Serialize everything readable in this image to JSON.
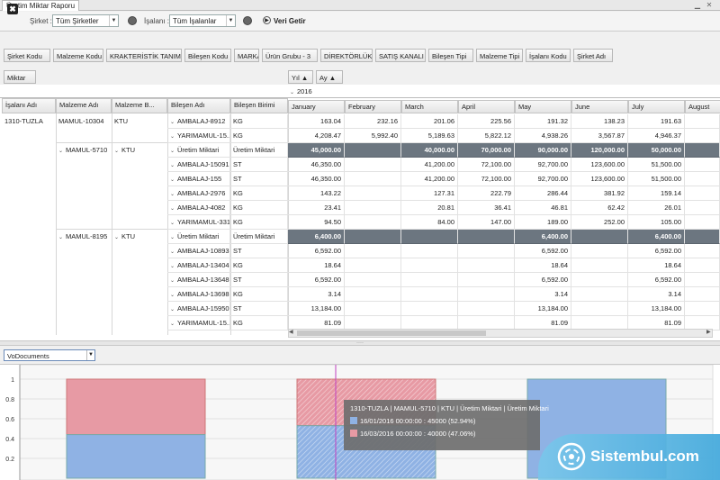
{
  "window": {
    "title": "Üretim Miktar Raporu"
  },
  "toolbar": {
    "sirket_label": "Şirket :",
    "sirket_value": "Tüm Şirketler",
    "isalani_label": "İşalanı :",
    "isalani_value": "Tüm İşalanlar",
    "run_label": "Veri Getir"
  },
  "filter_fields": [
    "Şirket Kodu",
    "Malzeme Kodu",
    "KRAKTERİSTİK TANIM",
    "Bileşen Kodu",
    "MARKA",
    "Ürün Grubu - 3",
    "DİREKTÖRLÜK",
    "SATIŞ KANALI",
    "Bileşen Tipi",
    "Malzeme Tipi",
    "İşalanı Kodu",
    "Şirket Adı"
  ],
  "data_field": "Miktar",
  "column_fields": {
    "yil": "Yıl",
    "ay": "Ay"
  },
  "row_headers": [
    "İşalanı Adı",
    "Malzeme Adı",
    "Malzeme B...",
    "Bileşen Adı",
    "Bileşen Birimi"
  ],
  "year": "2016",
  "months": [
    "January",
    "February",
    "March",
    "April",
    "May",
    "June",
    "July",
    "August"
  ],
  "groups": [
    {
      "isalani": "1310-TUZLA",
      "malzeme": "MAMUL-10304",
      "malzeme_b": "KTU"
    },
    {
      "malzeme": "MAMUL-5710",
      "malzeme_b": "KTU"
    },
    {
      "malzeme": "MAMUL-8195",
      "malzeme_b": "KTU"
    }
  ],
  "rows": [
    {
      "bilesen": "AMBALAJ-8912",
      "birim": "KG",
      "total": false,
      "values": [
        "163.04",
        "232.16",
        "201.06",
        "225.56",
        "191.32",
        "138.23",
        "191.63"
      ]
    },
    {
      "bilesen": "YARIMAMUL-15...",
      "birim": "KG",
      "total": false,
      "values": [
        "4,208.47",
        "5,992.40",
        "5,189.63",
        "5,822.12",
        "4,938.26",
        "3,567.87",
        "4,946.37"
      ]
    },
    {
      "bilesen": "Üretim Miktari",
      "birim": "Üretim Miktari",
      "total": true,
      "values": [
        "45,000.00",
        "",
        "40,000.00",
        "70,000.00",
        "90,000.00",
        "120,000.00",
        "50,000.00"
      ]
    },
    {
      "bilesen": "AMBALAJ-15091",
      "birim": "ST",
      "total": false,
      "values": [
        "46,350.00",
        "",
        "41,200.00",
        "72,100.00",
        "92,700.00",
        "123,600.00",
        "51,500.00"
      ]
    },
    {
      "bilesen": "AMBALAJ-155",
      "birim": "ST",
      "total": false,
      "values": [
        "46,350.00",
        "",
        "41,200.00",
        "72,100.00",
        "92,700.00",
        "123,600.00",
        "51,500.00"
      ]
    },
    {
      "bilesen": "AMBALAJ-2976",
      "birim": "KG",
      "total": false,
      "values": [
        "143.22",
        "",
        "127.31",
        "222.79",
        "286.44",
        "381.92",
        "159.14"
      ]
    },
    {
      "bilesen": "AMBALAJ-4082",
      "birim": "KG",
      "total": false,
      "values": [
        "23.41",
        "",
        "20.81",
        "36.41",
        "46.81",
        "62.42",
        "26.01"
      ]
    },
    {
      "bilesen": "YARIMAMUL-3319",
      "birim": "KG",
      "total": false,
      "values": [
        "94.50",
        "",
        "84.00",
        "147.00",
        "189.00",
        "252.00",
        "105.00"
      ]
    },
    {
      "bilesen": "Üretim Miktari",
      "birim": "Üretim Miktari",
      "total": true,
      "values": [
        "6,400.00",
        "",
        "",
        "",
        "6,400.00",
        "",
        "6,400.00"
      ]
    },
    {
      "bilesen": "AMBALAJ-10893",
      "birim": "ST",
      "total": false,
      "values": [
        "6,592.00",
        "",
        "",
        "",
        "6,592.00",
        "",
        "6,592.00"
      ]
    },
    {
      "bilesen": "AMBALAJ-13404",
      "birim": "KG",
      "total": false,
      "values": [
        "18.64",
        "",
        "",
        "",
        "18.64",
        "",
        "18.64"
      ]
    },
    {
      "bilesen": "AMBALAJ-13648",
      "birim": "ST",
      "total": false,
      "values": [
        "6,592.00",
        "",
        "",
        "",
        "6,592.00",
        "",
        "6,592.00"
      ]
    },
    {
      "bilesen": "AMBALAJ-13698",
      "birim": "KG",
      "total": false,
      "values": [
        "3.14",
        "",
        "",
        "",
        "3.14",
        "",
        "3.14"
      ]
    },
    {
      "bilesen": "AMBALAJ-15950",
      "birim": "ST",
      "total": false,
      "values": [
        "13,184.00",
        "",
        "",
        "",
        "13,184.00",
        "",
        "13,184.00"
      ]
    },
    {
      "bilesen": "YARIMAMUL-15...",
      "birim": "KG",
      "total": false,
      "values": [
        "81.09",
        "",
        "",
        "",
        "81.09",
        "",
        "81.09"
      ]
    }
  ],
  "chart_selector": "VoDocuments",
  "chart_data": {
    "type": "bar",
    "stacked": "100%",
    "ylim": [
      0,
      1
    ],
    "yticks": [
      "1",
      "0.8",
      "0.6",
      "0.4",
      "0.2"
    ],
    "bars": [
      {
        "blue": 0.44,
        "red": 0.56
      },
      {
        "blue": 0.53,
        "red": 0.47,
        "highlight": true
      },
      {
        "blue": 1.0,
        "red": 0
      }
    ],
    "colors": {
      "blue": "#8fb2e4",
      "red": "#e79aa4"
    }
  },
  "tooltip": {
    "title": "1310-TUZLA | MAMUL-5710 | KTU | Üretim Miktari | Üretim Miktari",
    "line1": "16/01/2016 00:00:00 : 45000 (52.94%)",
    "line2": "16/03/2016 00:00:00 : 40000 (47.06%)"
  },
  "watermark": "Sistembul.com"
}
